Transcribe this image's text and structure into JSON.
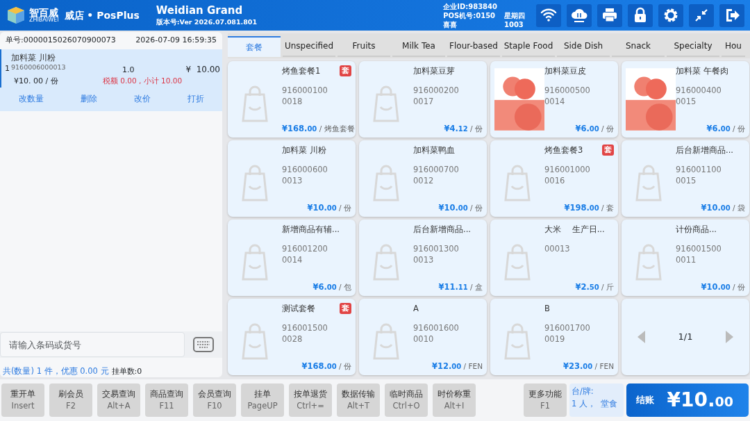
{
  "header": {
    "brand": "智百威",
    "brand_sub": "ZHIBAIWEI",
    "product": "威店 • PosPlus",
    "store": "Weidian Grand",
    "version": "版本号:Ver 2026.07.081.801",
    "company_id": "企业ID:983840",
    "pos_no": "POS机号:0150",
    "weekday": "星期四",
    "cashier": "喜喜",
    "cashier_no": "1003"
  },
  "order": {
    "number": "单号:0000015026070900073",
    "time": "2026-07-09 16:59:35",
    "items": [
      {
        "index": "1",
        "name": "加料菜 川粉",
        "code": "9160006000013",
        "qty": "1.0",
        "amount": "¥  10.00",
        "unit_price": "¥10. 00 / 份",
        "tax": "税额 0.00 , 小计 10.00",
        "selected": true
      }
    ],
    "actions": [
      "改数量",
      "删除",
      "改价",
      "打折"
    ],
    "search": {
      "placeholder": "请输入条码或货号"
    },
    "summary": "共(数量) 1 件，优惠 0.00 元",
    "held": "挂单数:0"
  },
  "tabs": [
    {
      "label": "套餐",
      "selected": true
    },
    {
      "label": "Unspecified",
      "selected": false
    },
    {
      "label": "Fruits",
      "selected": false
    },
    {
      "label": "Milk Tea",
      "selected": false
    },
    {
      "label": "Flour-based",
      "selected": false
    },
    {
      "label": "Staple Food",
      "selected": false
    },
    {
      "label": "Side Dish",
      "selected": false
    },
    {
      "label": "Snack",
      "selected": false
    },
    {
      "label": "Specialty",
      "selected": false
    },
    {
      "label": "Hou",
      "selected": false
    }
  ],
  "products": [
    {
      "kind": "placeholder",
      "name": "烤鱼套餐1",
      "badge": "套",
      "code": "9160001000018",
      "price": "¥168.",
      "cents": "00",
      "unit": "/ 烤鱼套餐"
    },
    {
      "kind": "placeholder",
      "name": "加料菜豆芽",
      "code": "9160002000017",
      "price": "¥4.",
      "cents": "12",
      "unit": "/ 份"
    },
    {
      "kind": "photo",
      "name": "加料菜豆皮",
      "code": "9160005000014",
      "price": "¥6.",
      "cents": "00",
      "unit": "/ 份"
    },
    {
      "kind": "photo",
      "name": "加料菜 午餐肉",
      "code": "9160004000015",
      "price": "¥6.",
      "cents": "00",
      "unit": "/ 份"
    },
    {
      "kind": "placeholder",
      "name": "加料菜 川粉",
      "code": "9160006000013",
      "price": "¥10.",
      "cents": "00",
      "unit": "/ 份"
    },
    {
      "kind": "placeholder",
      "name": "加料菜鸭血",
      "code": "9160007000012",
      "price": "¥10.",
      "cents": "00",
      "unit": "/ 份"
    },
    {
      "kind": "placeholder",
      "name": "烤鱼套餐3",
      "badge": "套",
      "code": "9160010000016",
      "price": "¥198.",
      "cents": "00",
      "unit": "/ 套"
    },
    {
      "kind": "placeholder",
      "name": "后台新增商品...",
      "code": "9160011000015",
      "price": "¥10.",
      "cents": "00",
      "unit": "/ 袋"
    },
    {
      "kind": "placeholder",
      "name": "新增商品有辅...",
      "code": "9160012000014",
      "price": "¥6.",
      "cents": "00",
      "unit": "/ 包"
    },
    {
      "kind": "placeholder",
      "name": "后台新增商品...",
      "code": "9160013000013",
      "price": "¥11.",
      "cents": "11",
      "unit": "/ 盒"
    },
    {
      "kind": "placeholder",
      "name": "大米　 生产日...",
      "code": "00013",
      "price": "¥2.",
      "cents": "50",
      "unit": "/ 斤"
    },
    {
      "kind": "placeholder",
      "name": "计份商品...",
      "code": "9160015000011",
      "price": "¥10.",
      "cents": "00",
      "unit": "/ 份"
    },
    {
      "kind": "placeholder",
      "name": "测试套餐",
      "badge": "套",
      "code": "9160015000028",
      "price": "¥168.",
      "cents": "00",
      "unit": "/ 份"
    },
    {
      "kind": "placeholder",
      "name": "A",
      "code": "9160016000010",
      "price": "¥12.",
      "cents": "00",
      "unit": "/ FEN"
    },
    {
      "kind": "placeholder",
      "name": "B",
      "code": "9160017000019",
      "price": "¥23.",
      "cents": "00",
      "unit": "/ FEN"
    }
  ],
  "pager": "1/1",
  "functions": [
    {
      "label": "重开单",
      "key": "Insert"
    },
    {
      "label": "刷会员",
      "key": "F2"
    },
    {
      "label": "交易查询",
      "key": "Alt+A"
    },
    {
      "label": "商品查询",
      "key": "F11"
    },
    {
      "label": "会员查询",
      "key": "F10"
    },
    {
      "label": "挂单",
      "key": "PageUP"
    },
    {
      "label": "按单退货",
      "key": "Ctrl+="
    },
    {
      "label": "数据传输",
      "key": "Alt+T"
    },
    {
      "label": "临时商品",
      "key": "Ctrl+O"
    },
    {
      "label": "时价称重",
      "key": "Alt+I"
    }
  ],
  "more": {
    "label": "更多功能",
    "key": "F1"
  },
  "table_info": {
    "line1": "台/牌:",
    "line2": "1 人，  堂食"
  },
  "checkout": {
    "label": "结账",
    "amount": "¥10.",
    "cents": "00"
  }
}
